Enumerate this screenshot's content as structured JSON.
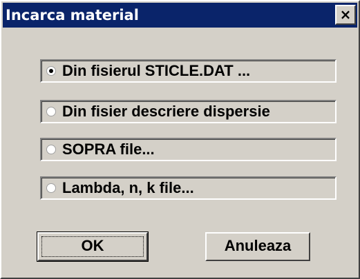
{
  "window": {
    "title": "Incarca material",
    "close_glyph": "×"
  },
  "options": [
    {
      "label": "Din fisierul STICLE.DAT ...",
      "selected": true
    },
    {
      "label": "Din fisier descriere dispersie",
      "selected": false
    },
    {
      "label": "SOPRA file...",
      "selected": false
    },
    {
      "label": "Lambda, n, k file...",
      "selected": false
    }
  ],
  "buttons": {
    "ok_label": "OK",
    "cancel_label": "Anuleaza"
  }
}
